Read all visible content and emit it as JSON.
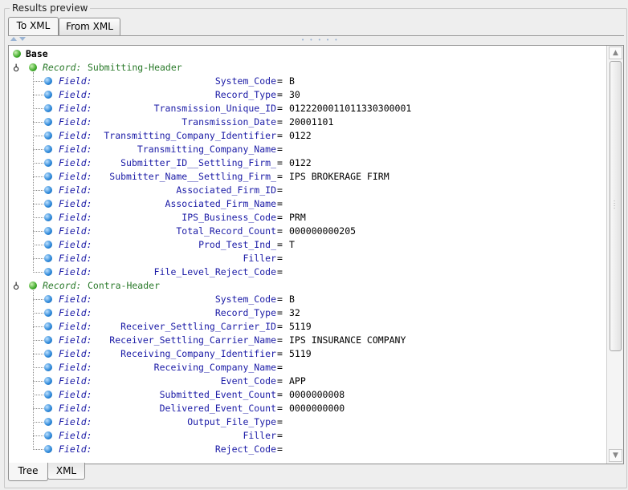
{
  "group": {
    "title": "Results preview"
  },
  "top_tabs": [
    {
      "label": "To XML",
      "active": true
    },
    {
      "label": "From XML",
      "active": false
    }
  ],
  "bottom_tabs": [
    {
      "label": "Tree",
      "active": true
    },
    {
      "label": "XML",
      "active": false
    }
  ],
  "tree": {
    "root_label": "Base",
    "record_prefix": "Record:",
    "field_prefix": "Field:",
    "records": [
      {
        "name": "Submitting-Header",
        "fields": [
          {
            "name": "System_Code",
            "value": "B"
          },
          {
            "name": "Record_Type",
            "value": "30"
          },
          {
            "name": "Transmission_Unique_ID",
            "value": "0122200011011330300001"
          },
          {
            "name": "Transmission_Date",
            "value": "20001101"
          },
          {
            "name": "Transmitting_Company_Identifier",
            "value": "0122"
          },
          {
            "name": "Transmitting_Company_Name",
            "value": ""
          },
          {
            "name": "Submitter_ID__Settling_Firm_",
            "value": "0122"
          },
          {
            "name": "Submitter_Name__Settling_Firm_",
            "value": "IPS BROKERAGE FIRM"
          },
          {
            "name": "Associated_Firm_ID",
            "value": ""
          },
          {
            "name": "Associated_Firm_Name",
            "value": ""
          },
          {
            "name": "IPS_Business_Code",
            "value": "PRM"
          },
          {
            "name": "Total_Record_Count",
            "value": "000000000205"
          },
          {
            "name": "Prod_Test_Ind_",
            "value": "T"
          },
          {
            "name": "Filler",
            "value": ""
          },
          {
            "name": "File_Level_Reject_Code",
            "value": ""
          }
        ]
      },
      {
        "name": "Contra-Header",
        "fields": [
          {
            "name": "System_Code",
            "value": "B"
          },
          {
            "name": "Record_Type",
            "value": "32"
          },
          {
            "name": "Receiver_Settling_Carrier_ID",
            "value": "5119"
          },
          {
            "name": "Receiver_Settling_Carrier_Name",
            "value": "IPS INSURANCE COMPANY"
          },
          {
            "name": "Receiving_Company_Identifier",
            "value": "5119"
          },
          {
            "name": "Receiving_Company_Name",
            "value": ""
          },
          {
            "name": "Event_Code",
            "value": "APP"
          },
          {
            "name": "Submitted_Event_Count",
            "value": "0000000008"
          },
          {
            "name": "Delivered_Event_Count",
            "value": "0000000000"
          },
          {
            "name": "Output_File_Type",
            "value": ""
          },
          {
            "name": "Filler",
            "value": ""
          },
          {
            "name": "Reject_Code",
            "value": ""
          }
        ]
      }
    ]
  }
}
